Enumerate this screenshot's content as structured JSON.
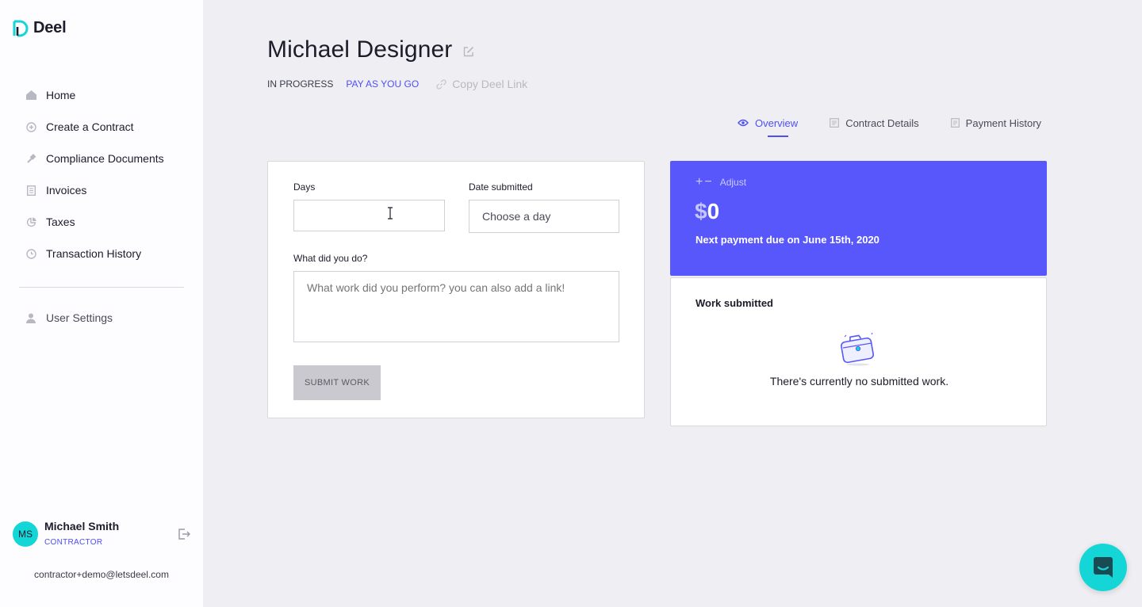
{
  "brand": {
    "name": "Deel"
  },
  "sidebar": {
    "items": [
      {
        "label": "Home",
        "icon": "home-icon"
      },
      {
        "label": "Create a Contract",
        "icon": "plus-circle-icon"
      },
      {
        "label": "Compliance Documents",
        "icon": "gavel-icon"
      },
      {
        "label": "Invoices",
        "icon": "document-icon"
      },
      {
        "label": "Taxes",
        "icon": "pie-chart-icon"
      },
      {
        "label": "Transaction History",
        "icon": "clock-icon"
      }
    ],
    "settings_label": "User Settings",
    "user": {
      "initials": "MS",
      "name": "Michael Smith",
      "role": "CONTRACTOR",
      "email": "contractor+demo@letsdeel.com"
    }
  },
  "header": {
    "title": "Michael Designer",
    "status": "IN PROGRESS",
    "type": "PAY AS YOU GO",
    "copy_link": "Copy Deel Link"
  },
  "tabs": [
    {
      "label": "Overview",
      "active": true
    },
    {
      "label": "Contract Details",
      "active": false
    },
    {
      "label": "Payment History",
      "active": false
    }
  ],
  "form": {
    "days_label": "Days",
    "days_value": "",
    "date_label": "Date submitted",
    "date_placeholder": "Choose a day",
    "work_label": "What did you do?",
    "work_placeholder": "What work did you perform? you can also add a link!",
    "submit_label": "SUBMIT WORK"
  },
  "payment": {
    "adjust_label": "Adjust",
    "currency": "$",
    "amount": "0",
    "next_payment": "Next payment due on June 15th, 2020"
  },
  "work_submitted": {
    "title": "Work submitted",
    "empty_text": "There's currently no submitted work."
  },
  "colors": {
    "accent": "#5757fb",
    "teal": "#14d6d6",
    "background": "#efeff3"
  }
}
